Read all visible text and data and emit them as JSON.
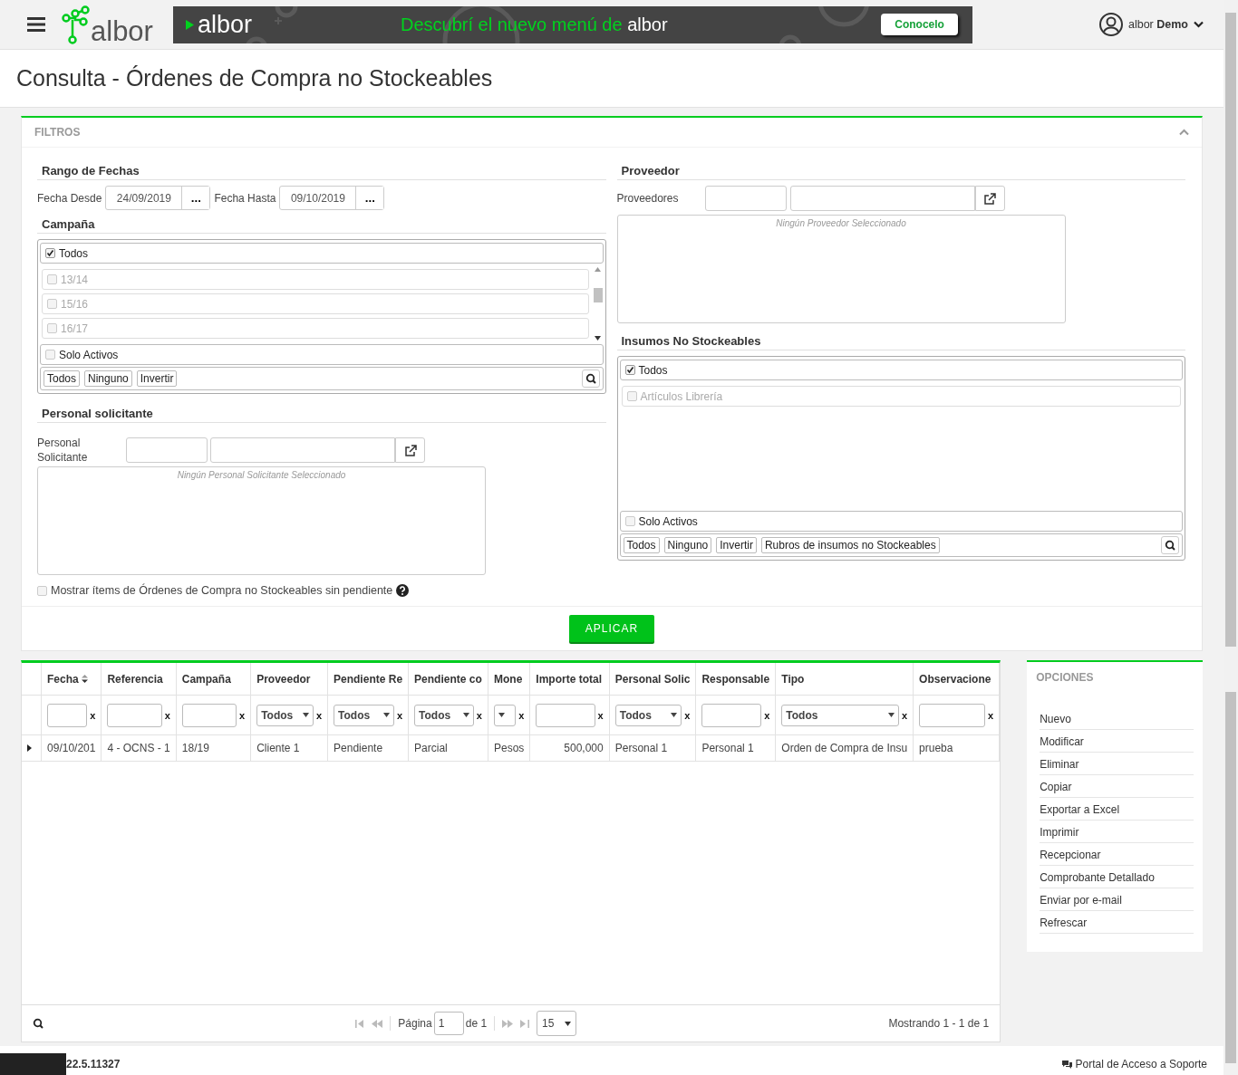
{
  "header": {
    "logo_text": "albor",
    "banner": {
      "brand": "albor",
      "message": "Descubrí el nuevo menú de",
      "message_brand": "albor",
      "button": "Conocelo"
    },
    "user": {
      "label": "albor **Demo**"
    }
  },
  "page_title": "Consulta - Órdenes de Compra no Stockeables",
  "filters": {
    "title": "FILTROS",
    "expanded": true,
    "date_range": {
      "heading": "Rango de Fechas",
      "fields": [
        {
          "label": "Fecha Desde",
          "value": "24/09/2019",
          "picker": "..."
        },
        {
          "label": "Fecha Hasta",
          "value": "09/10/2019",
          "picker": "..."
        }
      ]
    },
    "campaign": {
      "heading": "Campaña",
      "all": {
        "label": "Todos",
        "checked": true
      },
      "items": [
        {
          "label": "13/14",
          "checked": false,
          "disabled": true
        },
        {
          "label": "15/16",
          "checked": false,
          "disabled": true
        },
        {
          "label": "16/17",
          "checked": false,
          "disabled": true
        }
      ],
      "only_active": {
        "label": "Solo Activos",
        "checked": false
      },
      "buttons": [
        "Todos",
        "Ninguno",
        "Invertir"
      ]
    },
    "staff": {
      "heading": "Personal solicitante",
      "label": "Personal Solicitante",
      "empty_text": "Ningún Personal Solicitante Seleccionado"
    },
    "show_no_pending": {
      "label": "Mostrar ítems de Órdenes de Compra no Stockeables sin pendiente",
      "checked": false
    },
    "supplier": {
      "heading": "Proveedor",
      "label": "Proveedores",
      "empty_text": "Ningún Proveedor Seleccionado"
    },
    "supplies": {
      "heading": "Insumos No Stockeables",
      "all": {
        "label": "Todos",
        "checked": true
      },
      "items": [
        {
          "label": "Artículos Librería",
          "checked": false,
          "disabled": true
        }
      ],
      "only_active": {
        "label": "Solo Activos",
        "checked": false
      },
      "buttons": [
        "Todos",
        "Ninguno",
        "Invertir",
        "Rubros de insumos no Stockeables"
      ]
    },
    "apply_button": "APLICAR"
  },
  "grid": {
    "columns": [
      {
        "label": "Fecha",
        "sorted": true,
        "filter": {
          "kind": "text",
          "clear": "x"
        }
      },
      {
        "label": "Referencia",
        "sorted": false,
        "filter": {
          "kind": "text",
          "clear": "x"
        }
      },
      {
        "label": "Campaña",
        "sorted": false,
        "filter": {
          "kind": "text",
          "clear": "x"
        }
      },
      {
        "label": "Proveedor",
        "sorted": false,
        "filter": {
          "kind": "select",
          "value": "Todos",
          "clear": "x"
        }
      },
      {
        "label": "Pendiente Re",
        "sorted": false,
        "filter": {
          "kind": "select",
          "value": "Todos",
          "clear": "x"
        }
      },
      {
        "label": "Pendiente co",
        "sorted": false,
        "filter": {
          "kind": "select",
          "value": "Todos",
          "clear": "x"
        }
      },
      {
        "label": "Mone",
        "sorted": false,
        "filter": {
          "kind": "select",
          "clear": "x"
        }
      },
      {
        "label": "Importe total",
        "sorted": false,
        "filter": {
          "kind": "text",
          "clear": "x"
        }
      },
      {
        "label": "Personal Solic",
        "sorted": false,
        "filter": {
          "kind": "select",
          "value": "Todos",
          "clear": "x"
        }
      },
      {
        "label": "Responsable",
        "sorted": false,
        "filter": {
          "kind": "text",
          "clear": "x"
        }
      },
      {
        "label": "Tipo",
        "sorted": false,
        "filter": {
          "kind": "select",
          "value": "Todos",
          "clear": "x"
        }
      },
      {
        "label": "Observacione",
        "sorted": false,
        "filter": {
          "kind": "text",
          "clear": "x"
        }
      }
    ],
    "rows": [
      {
        "expanded": false,
        "cells": [
          "09/10/201",
          "4 - OCNS - 1",
          "18/19",
          "Cliente 1",
          "Pendiente",
          "Parcial",
          "Pesos",
          "500,000",
          "Personal 1",
          "Personal 1",
          "Orden de Compra de Insu",
          "prueba"
        ]
      }
    ],
    "pager": {
      "page_label": "Página",
      "page": "1",
      "of_label": "de 1",
      "page_size": "15",
      "summary": "Mostrando 1 - 1 de 1"
    }
  },
  "options": {
    "title": "OPCIONES",
    "items": [
      "Nuevo",
      "Modificar",
      "Eliminar",
      "Copiar",
      "Exportar a Excel",
      "Imprimir",
      "Recepcionar",
      "Comprobante Detallado",
      "Enviar por e-mail",
      "Refrescar"
    ]
  },
  "footer": {
    "version": "22.5.11327",
    "support_link": "Portal de Acceso a Soporte"
  }
}
